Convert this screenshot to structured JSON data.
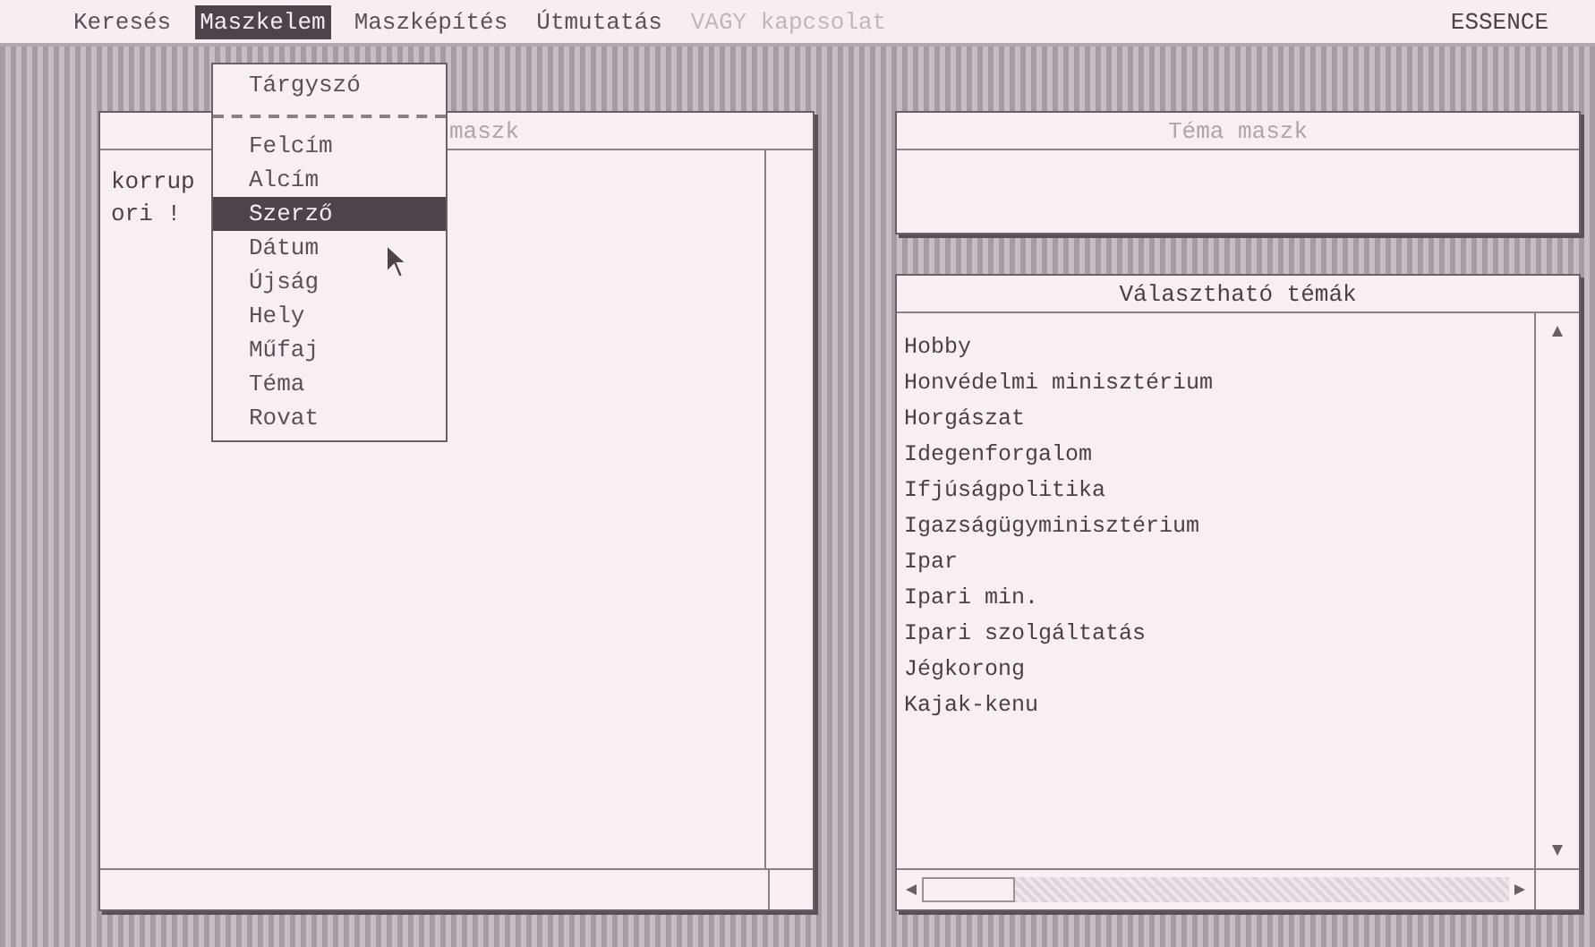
{
  "menu_bar": {
    "items": [
      {
        "label": "Keresés",
        "selected": false,
        "disabled": false
      },
      {
        "label": "Maszkelem",
        "selected": true,
        "disabled": false
      },
      {
        "label": "Maszképítés",
        "selected": false,
        "disabled": false
      },
      {
        "label": "Útmutatás",
        "selected": false,
        "disabled": false
      },
      {
        "label": "VAGY kapcsolat",
        "selected": false,
        "disabled": true
      }
    ],
    "app_name": "ESSENCE"
  },
  "dropdown": {
    "items": [
      {
        "kind": "item",
        "label": "Tárgyszó",
        "selected": false
      },
      {
        "kind": "separator"
      },
      {
        "kind": "item",
        "label": "Felcím",
        "selected": false
      },
      {
        "kind": "item",
        "label": "Alcím",
        "selected": false
      },
      {
        "kind": "item",
        "label": "Szerző",
        "selected": true
      },
      {
        "kind": "item",
        "label": "Dátum",
        "selected": false
      },
      {
        "kind": "item",
        "label": "Újság",
        "selected": false
      },
      {
        "kind": "item",
        "label": "Hely",
        "selected": false
      },
      {
        "kind": "item",
        "label": "Műfaj",
        "selected": false
      },
      {
        "kind": "item",
        "label": "Téma",
        "selected": false
      },
      {
        "kind": "item",
        "label": "Rovat",
        "selected": false
      }
    ]
  },
  "mask_panel": {
    "title": "maszk",
    "lines": [
      "korrup",
      "ori !"
    ]
  },
  "topic_mask_panel": {
    "title": "Téma maszk"
  },
  "topics_panel": {
    "title": "Választható témák",
    "items": [
      "Hobby",
      "Honvédelmi minisztérium",
      "Horgászat",
      "Idegenforgalom",
      "Ifjúságpolitika",
      "Igazságügyminisztérium",
      "Ipar",
      "Ipari min.",
      "Ipari szolgáltatás",
      "Jégkorong",
      "Kajak-kenu"
    ]
  }
}
